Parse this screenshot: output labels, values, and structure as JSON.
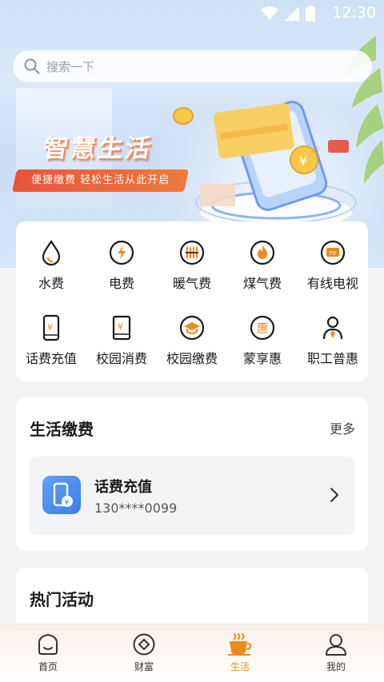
{
  "status": {
    "time": "12:30"
  },
  "search": {
    "placeholder": "搜索一下"
  },
  "banner": {
    "title": "智慧生活",
    "subtitle": "便捷缴费 轻松生活从此开启"
  },
  "services": [
    {
      "label": "水费",
      "icon": "water-drop-icon"
    },
    {
      "label": "电费",
      "icon": "lightning-icon"
    },
    {
      "label": "暖气费",
      "icon": "radiator-icon"
    },
    {
      "label": "煤气费",
      "icon": "flame-icon"
    },
    {
      "label": "有线电视",
      "icon": "tv-icon",
      "icon_text": "TV"
    },
    {
      "label": "话费充值",
      "icon": "phone-yen-icon"
    },
    {
      "label": "校园消费",
      "icon": "book-yen-icon"
    },
    {
      "label": "校园缴费",
      "icon": "graduation-cap-icon"
    },
    {
      "label": "蒙享惠",
      "icon": "hui-badge-icon",
      "icon_text": "惠"
    },
    {
      "label": "职工普惠",
      "icon": "worker-icon"
    }
  ],
  "life_payment": {
    "title": "生活缴费",
    "more": "更多",
    "item": {
      "title": "话费充值",
      "number": "130****0099"
    }
  },
  "hot": {
    "title": "热门活动"
  },
  "tabbar": [
    {
      "label": "首页",
      "icon": "home-icon",
      "active": false
    },
    {
      "label": "财富",
      "icon": "wealth-icon",
      "active": false
    },
    {
      "label": "生活",
      "icon": "coffee-cup-icon",
      "active": true
    },
    {
      "label": "我的",
      "icon": "profile-icon",
      "active": false
    }
  ],
  "colors": {
    "accent": "#f08a1c",
    "icon_stroke": "#1a1a1a",
    "tab_active": "#f08a1c"
  }
}
